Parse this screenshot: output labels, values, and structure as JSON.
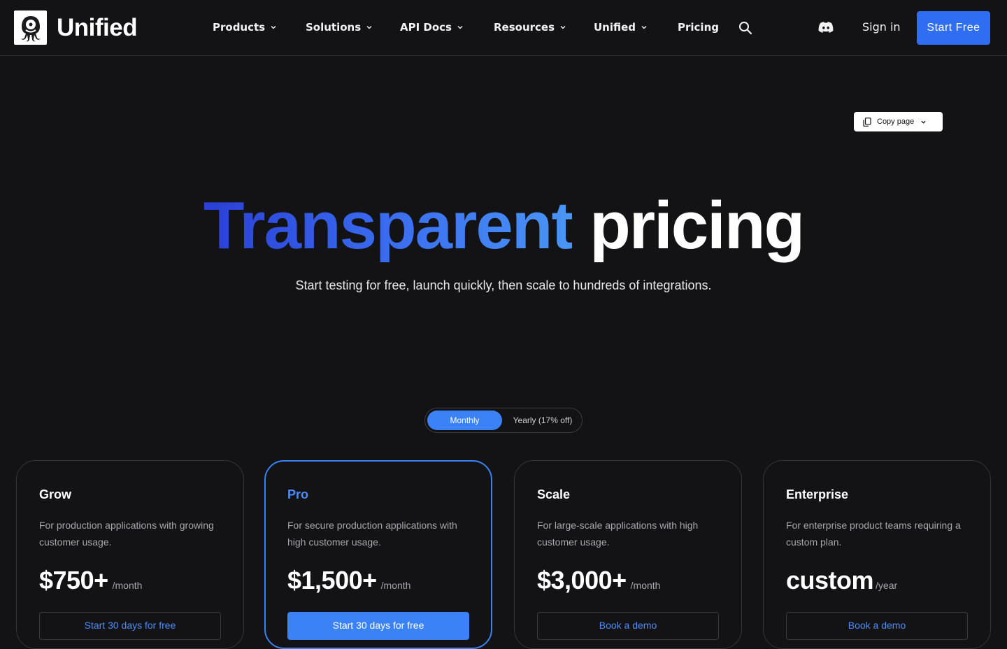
{
  "brand": {
    "name": "Unified"
  },
  "nav": {
    "items": [
      {
        "label": "Products",
        "has_dropdown": true
      },
      {
        "label": "Solutions",
        "has_dropdown": true
      },
      {
        "label": "API Docs",
        "has_dropdown": true
      },
      {
        "label": "Resources",
        "has_dropdown": true
      },
      {
        "label": "Unified",
        "has_dropdown": true
      },
      {
        "label": "Pricing",
        "has_dropdown": false
      }
    ],
    "search_icon": "search-icon",
    "discord_icon": "discord-icon",
    "sign_in": "Sign in",
    "start_free": "Start Free"
  },
  "copy_page": {
    "label": "Copy page",
    "icon": "copy-icon"
  },
  "hero": {
    "title_highlight": "Transparent",
    "title_rest": "pricing",
    "subtitle": "Start testing for free, launch quickly, then scale to hundreds of integrations."
  },
  "billing_toggle": {
    "options": [
      "Monthly",
      "Yearly (17% off)"
    ],
    "selected": "Monthly"
  },
  "plans": [
    {
      "name": "Grow",
      "description": "For production applications with growing customer usage.",
      "price": "$750+",
      "period": "/month",
      "cta": "Start 30 days for free",
      "highlighted": false
    },
    {
      "name": "Pro",
      "description": "For secure production applications with high customer usage.",
      "price": "$1,500+",
      "period": "/month",
      "cta": "Start 30 days for free",
      "highlighted": true
    },
    {
      "name": "Scale",
      "description": "For large-scale applications with high customer usage.",
      "price": "$3,000+",
      "period": "/month",
      "cta": "Book a demo",
      "highlighted": false
    },
    {
      "name": "Enterprise",
      "description": "For enterprise product teams requiring a custom plan.",
      "price": "custom",
      "period": "/year",
      "cta": "Book a demo",
      "highlighted": false
    }
  ],
  "colors": {
    "background": "#131316",
    "accent": "#3b82f6",
    "button_primary": "#2f6ef3",
    "muted_text": "#a6a6ad"
  }
}
